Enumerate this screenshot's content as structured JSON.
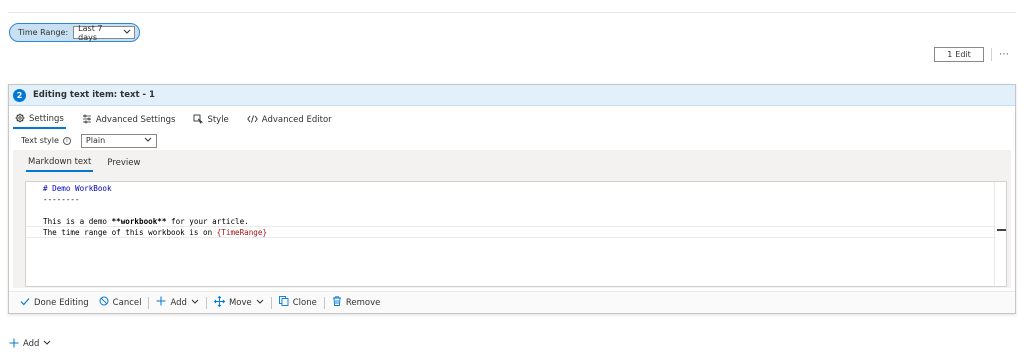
{
  "parameters": {
    "time_range_label": "Time Range:",
    "time_range_value": "Last 7 days"
  },
  "toolbar": {
    "edit_label": "Edit",
    "edit_count": "1",
    "more_label": "⋯"
  },
  "editor": {
    "step_number": "2",
    "header_title": "Editing text item: text - 1",
    "tabs": [
      {
        "label": "Settings"
      },
      {
        "label": "Advanced Settings"
      },
      {
        "label": "Style"
      },
      {
        "label": "Advanced Editor"
      }
    ],
    "text_style_label": "Text style",
    "text_style_value": "Plain",
    "content_tabs": [
      {
        "label": "Markdown text"
      },
      {
        "label": "Preview"
      }
    ],
    "code_lines": {
      "line1": "# Demo WorkBook",
      "line2": "--------",
      "line4_pre": "This is a demo ",
      "line4_bold": "**workbook**",
      "line4_post": " for your article.",
      "line5_pre": "The time range of this workbook is on ",
      "line5_param": "{TimeRange}"
    },
    "footer": {
      "done": "Done Editing",
      "cancel": "Cancel",
      "add": "Add",
      "move": "Move",
      "clone": "Clone",
      "remove": "Remove"
    }
  },
  "bottom_add_label": "Add",
  "colors": {
    "accent": "#0078d4",
    "header_bg": "#e1f0fb",
    "pill_bg": "#c7e0f4"
  },
  "icons": [
    "gear-icon",
    "sliders-icon",
    "style-icon",
    "code-icon",
    "info-icon",
    "chevron-down-icon",
    "check-icon",
    "cancel-icon",
    "plus-icon",
    "move-icon",
    "clone-icon",
    "trash-icon"
  ]
}
